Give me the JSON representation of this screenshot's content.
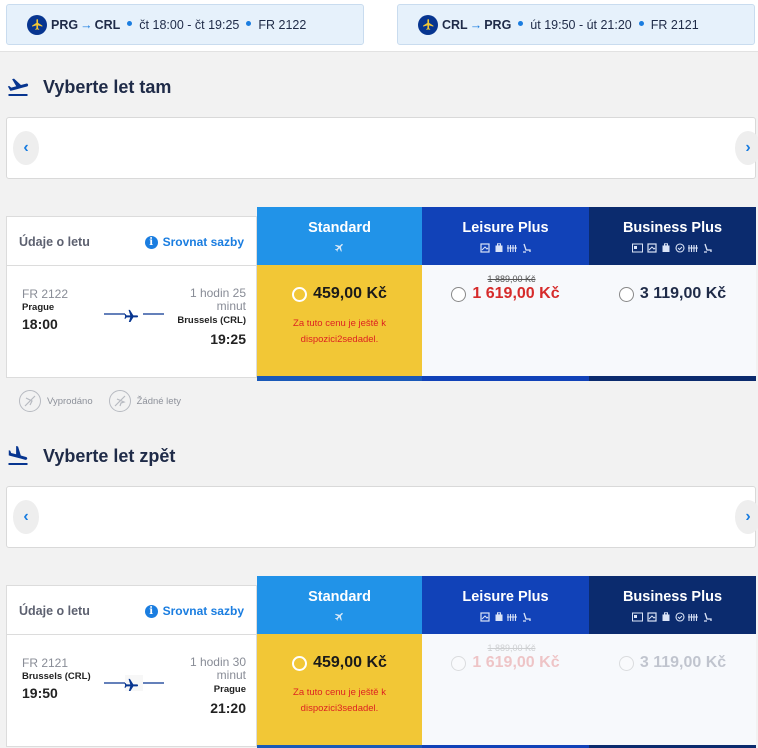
{
  "colors": {
    "brand_dark": "#073590",
    "accent_blue": "#1a7de0",
    "standard_header": "#2193e8",
    "standard_body": "#f2c736",
    "leisure_header": "#1142b8",
    "business_header": "#0b2b6e",
    "sale_red": "#d62b2b"
  },
  "summary": {
    "outbound": {
      "from": "PRG",
      "to": "CRL",
      "time": "čt 18:00 - čt 19:25",
      "flight": "FR 2122"
    },
    "return": {
      "from": "CRL",
      "to": "PRG",
      "time": "út 19:50 - út 21:20",
      "flight": "FR 2121"
    }
  },
  "outbound": {
    "title": "Vyberte let tam",
    "table": {
      "info_label": "Údaje o letu",
      "compare_label": "Srovnat sazby",
      "flight_number": "FR 2122",
      "origin": "Prague",
      "departure": "18:00",
      "duration": "1 hodin 25 minut",
      "destination": "Brussels (CRL)",
      "arrival": "19:25",
      "fares": {
        "standard": {
          "name": "Standard",
          "price": "459,00 Kč",
          "note": "Za tuto cenu je ještě k dispozici2sedadel."
        },
        "leisure": {
          "name": "Leisure Plus",
          "old_price": "1 889,00 Kč",
          "price": "1 619,00 Kč"
        },
        "business": {
          "name": "Business Plus",
          "price": "3 119,00 Kč"
        }
      }
    }
  },
  "legend": {
    "sold_out": "Vyprodáno",
    "no_flights": "Žádné lety"
  },
  "return": {
    "title": "Vyberte let zpět",
    "table": {
      "info_label": "Údaje o letu",
      "compare_label": "Srovnat sazby",
      "flight_number": "FR 2121",
      "origin": "Brussels (CRL)",
      "departure": "19:50",
      "duration": "1 hodin 30 minut",
      "destination": "Prague",
      "arrival": "21:20",
      "fares": {
        "standard": {
          "name": "Standard",
          "price": "459,00 Kč",
          "note": "Za tuto cenu je ještě k dispozici3sedadel."
        },
        "leisure": {
          "name": "Leisure Plus",
          "old_price": "1 889,00 Kč",
          "price": "1 619,00 Kč"
        },
        "business": {
          "name": "Business Plus",
          "price": "3 119,00 Kč"
        }
      }
    }
  }
}
